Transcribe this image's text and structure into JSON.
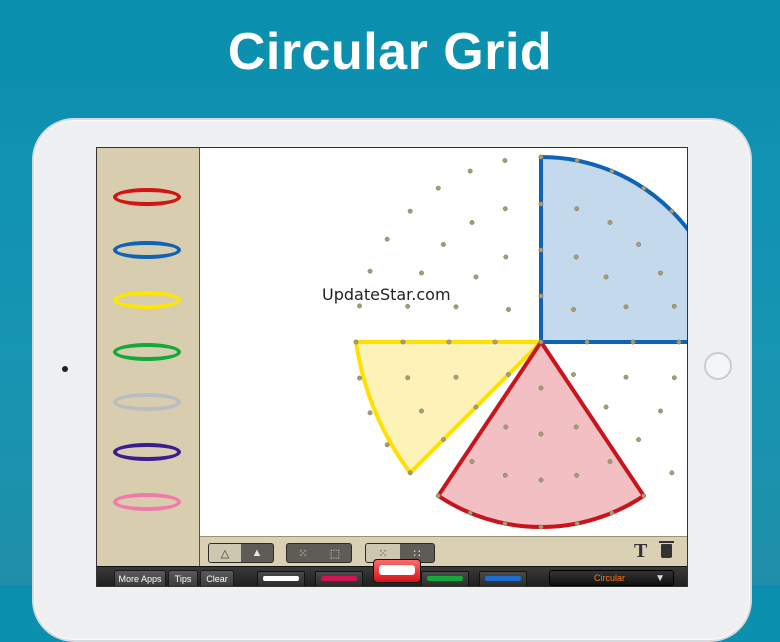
{
  "headline": "Circular Grid",
  "watermark": "UpdateStar.com",
  "bands": [
    {
      "color": "#d21414",
      "name": "red-band"
    },
    {
      "color": "#0e63b5",
      "name": "blue-band"
    },
    {
      "color": "#ffe600",
      "name": "yellow-band"
    },
    {
      "color": "#13a83a",
      "name": "green-band"
    },
    {
      "color": "#b9bcc0",
      "name": "gray-band"
    },
    {
      "color": "#3a1d8f",
      "name": "purple-band"
    },
    {
      "color": "#f07aa8",
      "name": "pink-band"
    }
  ],
  "toolbar": {
    "text_tool": "T",
    "shape_outline_icon": "triangle-outline-icon",
    "shape_filled_icon": "triangle-filled-icon",
    "pegs_icon": "pegs-icon",
    "square_icon": "square-icon",
    "grid_dense_icon": "grid-dense-icon",
    "grid_sparse_icon": "grid-sparse-icon",
    "trash_icon": "trash-icon"
  },
  "bottom": {
    "more_apps": "More Apps",
    "tips": "Tips",
    "clear": "Clear",
    "grid_type": "Circular"
  },
  "pens": [
    "#ffffff",
    "#d21452",
    "#ffffff",
    "#13a83a",
    "#1c6fd1"
  ],
  "shapes": {
    "blue": {
      "fill": "#c4d9ec",
      "stroke": "#0e63b5"
    },
    "yellow": {
      "fill": "#fdf3b8",
      "stroke": "#ffe000"
    },
    "red": {
      "fill": "#f2c0c3",
      "stroke": "#c8141c"
    }
  }
}
